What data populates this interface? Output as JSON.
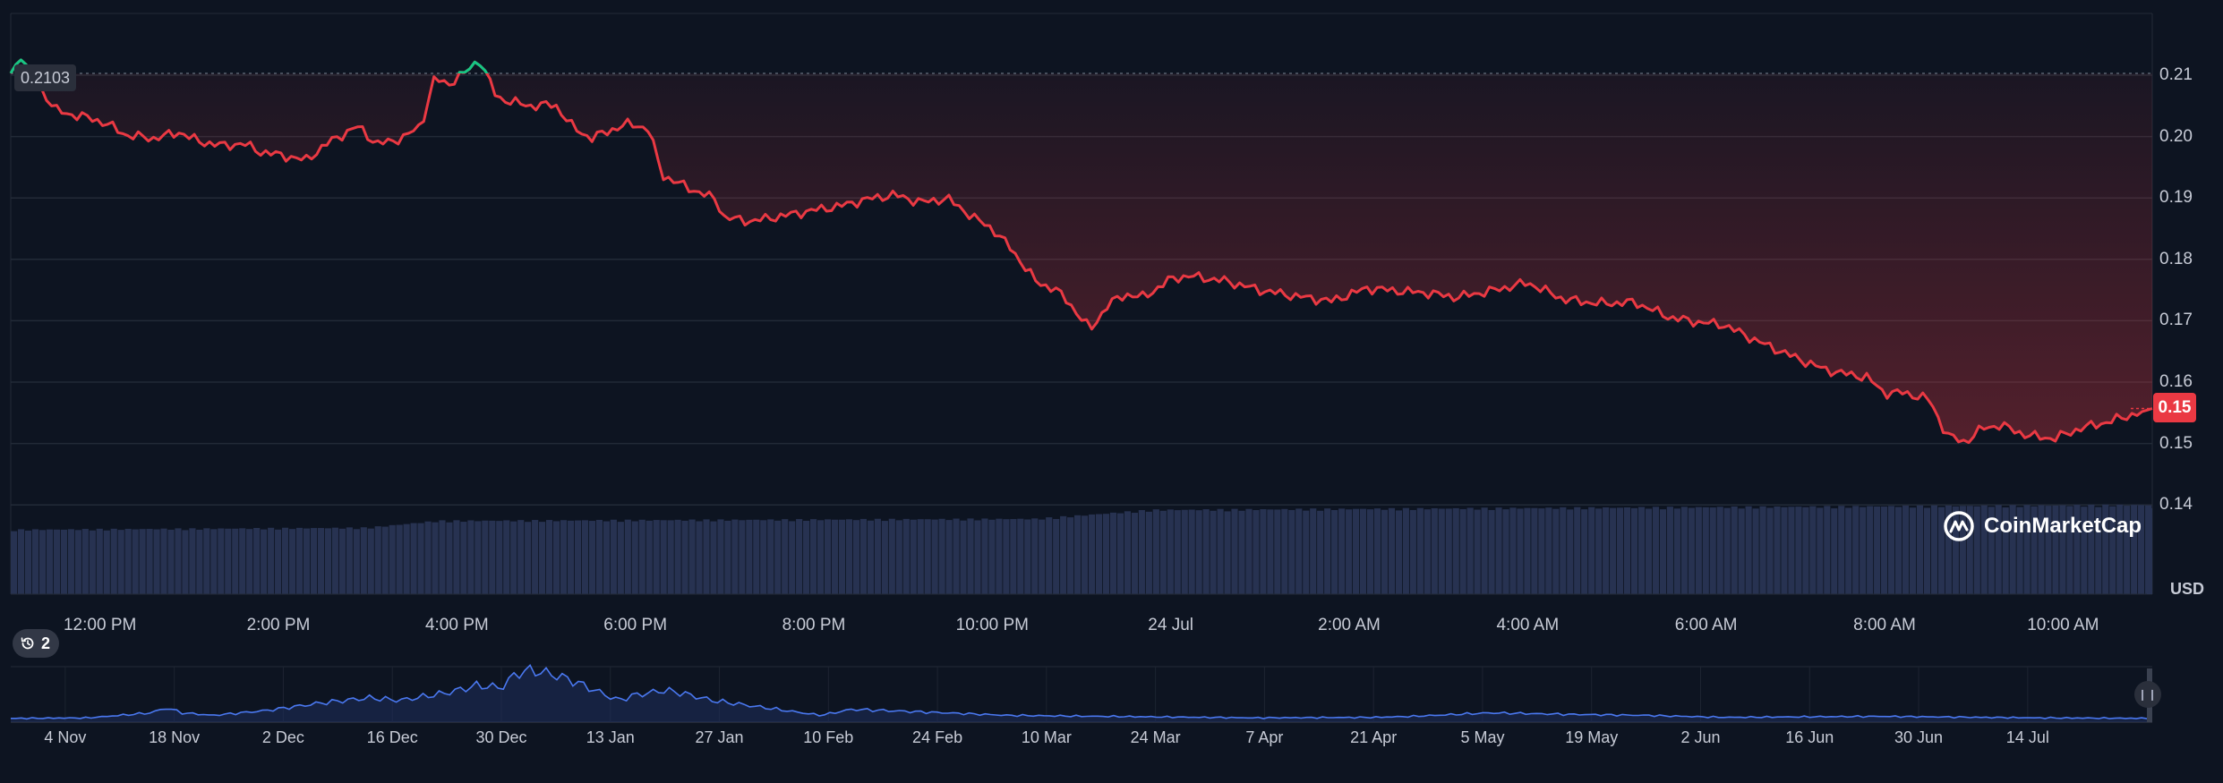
{
  "chart_data": [
    {
      "type": "line",
      "title": "",
      "xlabel": "",
      "ylabel": "",
      "currency": "USD",
      "ylim": [
        0.14,
        0.22
      ],
      "y_ticks": [
        "0.21",
        "0.20",
        "0.19",
        "0.18",
        "0.17",
        "0.16",
        "0.15",
        "0.14"
      ],
      "y_tick_values": [
        0.21,
        0.2,
        0.19,
        0.18,
        0.17,
        0.16,
        0.15,
        0.14
      ],
      "x_ticks": [
        "12:00 PM",
        "2:00 PM",
        "4:00 PM",
        "6:00 PM",
        "8:00 PM",
        "10:00 PM",
        "24 Jul",
        "2:00 AM",
        "4:00 AM",
        "6:00 AM",
        "8:00 AM",
        "10:00 AM"
      ],
      "x_tick_hours": [
        1,
        3,
        5,
        7,
        9,
        11,
        13,
        15,
        17,
        19,
        21,
        23
      ],
      "start_price_label": "0.2103",
      "start_price": 0.2103,
      "current_price_label": "0.15",
      "current_price": 0.1557,
      "up_color": "#16c784",
      "down_color": "#ea3943",
      "series": [
        {
          "x_hours": [
            0.0,
            0.1,
            0.5,
            0.7,
            0.9,
            1.1,
            1.3,
            1.6,
            1.9,
            2.1,
            2.4,
            2.6,
            2.8,
            3.1,
            3.3,
            3.6,
            3.9,
            4.1,
            4.4,
            4.6,
            4.75,
            4.9,
            5.1,
            5.25,
            5.45,
            5.8,
            6.1,
            6.3,
            6.5,
            6.7,
            6.9,
            7.0,
            7.15,
            7.3,
            7.6,
            7.9,
            8.0,
            8.3,
            8.7,
            9.0,
            9.3,
            9.6,
            9.9,
            10.2,
            10.5,
            10.8,
            11.0,
            11.2,
            11.5,
            11.7,
            11.85,
            12.1,
            12.3,
            12.5,
            12.7,
            13.0,
            13.2,
            13.6,
            14.0,
            14.4,
            14.8,
            15.2,
            15.6,
            15.9,
            16.2,
            16.6,
            17.0,
            17.4,
            17.8,
            18.2,
            18.6,
            18.9,
            19.2,
            19.6,
            20.0,
            20.3,
            20.5,
            20.8,
            21.0,
            21.2,
            21.5,
            21.7,
            21.9,
            22.1,
            22.3,
            22.6,
            22.9,
            23.2,
            23.5,
            23.8,
            24.0
          ],
          "y": [
            0.2103,
            0.2128,
            0.2043,
            0.2035,
            0.203,
            0.2019,
            0.2002,
            0.1997,
            0.2007,
            0.1992,
            0.1985,
            0.1989,
            0.1975,
            0.1968,
            0.1961,
            0.1994,
            0.2017,
            0.1987,
            0.1998,
            0.2018,
            0.2095,
            0.2085,
            0.2105,
            0.2126,
            0.2063,
            0.205,
            0.2052,
            0.2015,
            0.1997,
            0.2009,
            0.202,
            0.2019,
            0.2012,
            0.1937,
            0.1916,
            0.1898,
            0.1868,
            0.1862,
            0.1872,
            0.188,
            0.1887,
            0.1898,
            0.1905,
            0.1893,
            0.1899,
            0.1867,
            0.185,
            0.1819,
            0.1762,
            0.1752,
            0.1731,
            0.1685,
            0.1727,
            0.1743,
            0.1738,
            0.1768,
            0.1773,
            0.1765,
            0.175,
            0.174,
            0.1732,
            0.1753,
            0.1748,
            0.1745,
            0.1738,
            0.1749,
            0.1762,
            0.1735,
            0.1728,
            0.173,
            0.1705,
            0.1698,
            0.1693,
            0.1665,
            0.164,
            0.1622,
            0.1615,
            0.1608,
            0.1582,
            0.1583,
            0.1572,
            0.1513,
            0.1502,
            0.1525,
            0.153,
            0.1513,
            0.1508,
            0.1525,
            0.1535,
            0.1548,
            0.1557
          ]
        }
      ],
      "volume": {
        "x_hours": [
          0,
          4,
          4.8,
          11.5,
          12.8,
          24
        ],
        "relative_height": [
          0.65,
          0.67,
          0.74,
          0.76,
          0.85,
          0.9
        ]
      }
    },
    {
      "type": "area",
      "title": "",
      "xlabel": "",
      "ylabel": "",
      "x_ticks": [
        "4 Nov",
        "18 Nov",
        "2 Dec",
        "16 Dec",
        "30 Dec",
        "13 Jan",
        "27 Jan",
        "10 Feb",
        "24 Feb",
        "10 Mar",
        "24 Mar",
        "7 Apr",
        "21 Apr",
        "5 May",
        "19 May",
        "2 Jun",
        "16 Jun",
        "30 Jun",
        "14 Jul"
      ],
      "x_tick_days": [
        7,
        21,
        35,
        49,
        63,
        77,
        91,
        105,
        119,
        133,
        147,
        161,
        175,
        189,
        203,
        217,
        231,
        245,
        259
      ],
      "x_range_days": [
        0,
        275
      ],
      "series": [
        {
          "x_days": [
            0,
            10,
            18,
            20,
            22,
            26,
            33,
            40,
            46,
            50,
            56,
            60,
            63,
            65,
            67,
            70,
            72,
            75,
            78,
            80,
            84,
            86,
            90,
            97,
            104,
            108,
            115,
            120,
            128,
            140,
            160,
            175,
            180,
            190,
            200,
            210,
            220,
            240,
            260,
            275
          ],
          "y": [
            0.04,
            0.05,
            0.15,
            0.25,
            0.15,
            0.1,
            0.2,
            0.35,
            0.45,
            0.4,
            0.55,
            0.7,
            0.65,
            0.95,
            1.0,
            0.9,
            0.8,
            0.6,
            0.4,
            0.5,
            0.6,
            0.55,
            0.4,
            0.25,
            0.1,
            0.22,
            0.18,
            0.15,
            0.1,
            0.08,
            0.05,
            0.06,
            0.08,
            0.15,
            0.12,
            0.1,
            0.06,
            0.08,
            0.05,
            0.04
          ]
        }
      ]
    }
  ],
  "watermark": "CoinMarketCap",
  "currency_label": "USD",
  "history_count": "2",
  "history_icon": "history-clock-icon",
  "navigator_handle_icon": "pause-grip-icon"
}
